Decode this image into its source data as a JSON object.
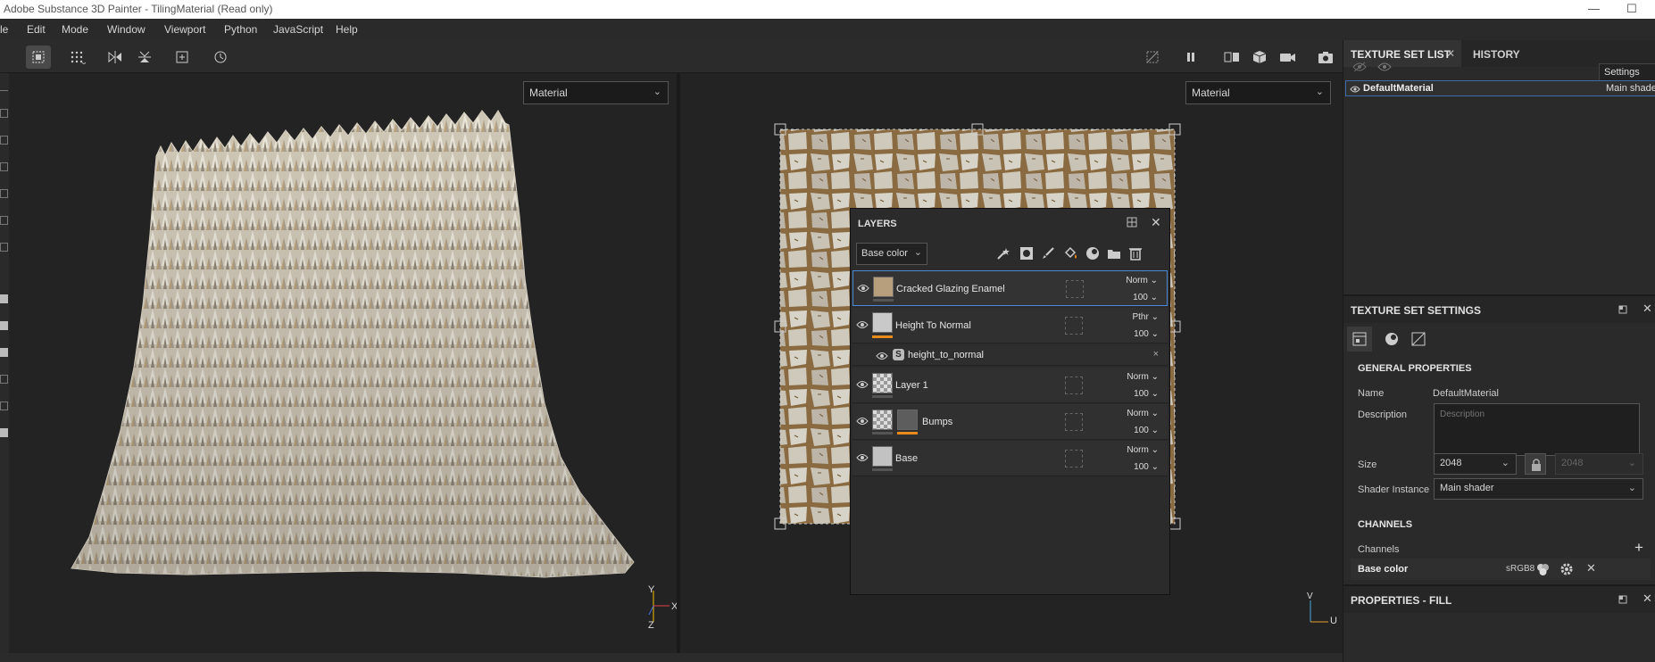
{
  "titlebar": {
    "title": "Adobe Substance 3D Painter - TilingMaterial (Read only)"
  },
  "menubar": {
    "items": [
      "le",
      "Edit",
      "Mode",
      "Window",
      "Viewport",
      "Python",
      "JavaScript",
      "Help"
    ]
  },
  "viewport3d": {
    "mode_dropdown": "Material",
    "axes": {
      "y": "Y",
      "x": "X",
      "z": "Z"
    }
  },
  "viewport2d": {
    "mode_dropdown": "Material",
    "axes": {
      "v": "V",
      "u": "U"
    }
  },
  "layers": {
    "title": "LAYERS",
    "channel_dropdown": "Base color",
    "rows": [
      {
        "name": "Cracked Glazing Enamel",
        "blend": "Norm",
        "opacity": "100"
      },
      {
        "name": "Height To Normal",
        "blend": "Pthr",
        "opacity": "100"
      },
      {
        "name": "height_to_normal",
        "type": "filter"
      },
      {
        "name": "Layer 1",
        "blend": "Norm",
        "opacity": "100"
      },
      {
        "name": "Bumps",
        "blend": "Norm",
        "opacity": "100"
      },
      {
        "name": "Base",
        "blend": "Norm",
        "opacity": "100"
      }
    ]
  },
  "texture_set_list": {
    "tabs": [
      "TEXTURE SET LIST",
      "HISTORY"
    ],
    "settings_label": "Settings",
    "item": {
      "name": "DefaultMaterial",
      "shader": "Main shader"
    }
  },
  "texture_set_settings": {
    "title": "TEXTURE SET SETTINGS",
    "general_title": "GENERAL PROPERTIES",
    "name_label": "Name",
    "name_value": "DefaultMaterial",
    "description_label": "Description",
    "description_placeholder": "Description",
    "size_label": "Size",
    "size_value": "2048",
    "size_value_locked": "2048",
    "shader_label": "Shader Instance",
    "shader_value": "Main shader",
    "channels_title": "CHANNELS",
    "channels_label": "Channels",
    "base_color_label": "Base color",
    "base_color_format": "sRGB8"
  },
  "properties": {
    "title": "PROPERTIES - FILL"
  },
  "colors": {
    "accent": "#2f7ed8",
    "orange": "#e88b1a",
    "panel": "#2a2a2a"
  }
}
